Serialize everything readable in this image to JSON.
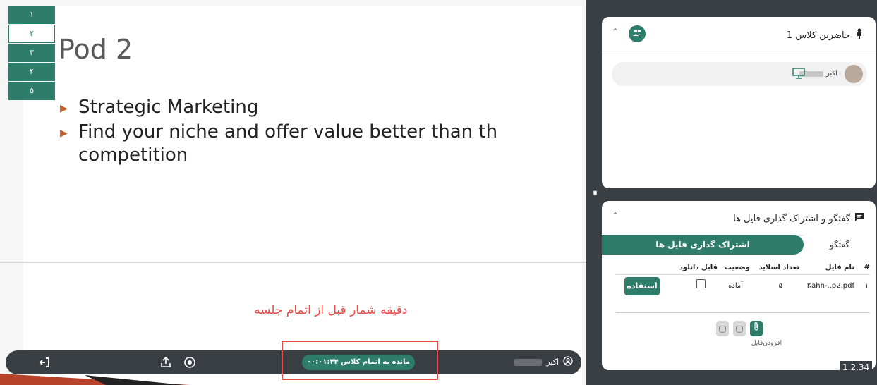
{
  "slide": {
    "title": "Pod 2",
    "bullets": [
      "Strategic Marketing",
      "Find your niche and offer value better than th competition"
    ]
  },
  "pages": [
    "۱",
    "۲",
    "۳",
    "۴",
    "۵"
  ],
  "active_page_index": 1,
  "annotation": "دقیقه شمار قبل از اتمام جلسه",
  "toolbar": {
    "timer_text": "مانده به اتمام کلاس ۰۰:۰۱:۴۴",
    "user_label": "اکبر"
  },
  "attendees_panel": {
    "title": "حاضرین کلاس 1",
    "attendee_name": "اکبر"
  },
  "chat_panel": {
    "title": "گفتگو و اشتراک گذاری فایل ها",
    "tabs": {
      "active": "اشتراک گذاری فایل ها",
      "inactive": "گفتگو"
    },
    "columns": [
      "#",
      "نام فایل",
      "تعداد اسلاید",
      "وضعیت",
      "قابل دانلود"
    ],
    "rows": [
      {
        "index": "۱",
        "file": "Kahn-..p2.pdf",
        "slides": "۵",
        "status": "آماده",
        "use_label": "استفاده"
      }
    ],
    "attach_label": "افزودن‌فایل"
  },
  "version": "1.2.34",
  "colors": {
    "accent": "#2e7d6b",
    "toolbar": "#3a3f44",
    "annotation": "#e74b45"
  },
  "icons": [
    "exit-icon",
    "share-icon",
    "record-icon",
    "user-icon",
    "person-icon",
    "group-icon",
    "monitor-icon",
    "chat-icon",
    "paperclip-icon",
    "file-icon"
  ]
}
